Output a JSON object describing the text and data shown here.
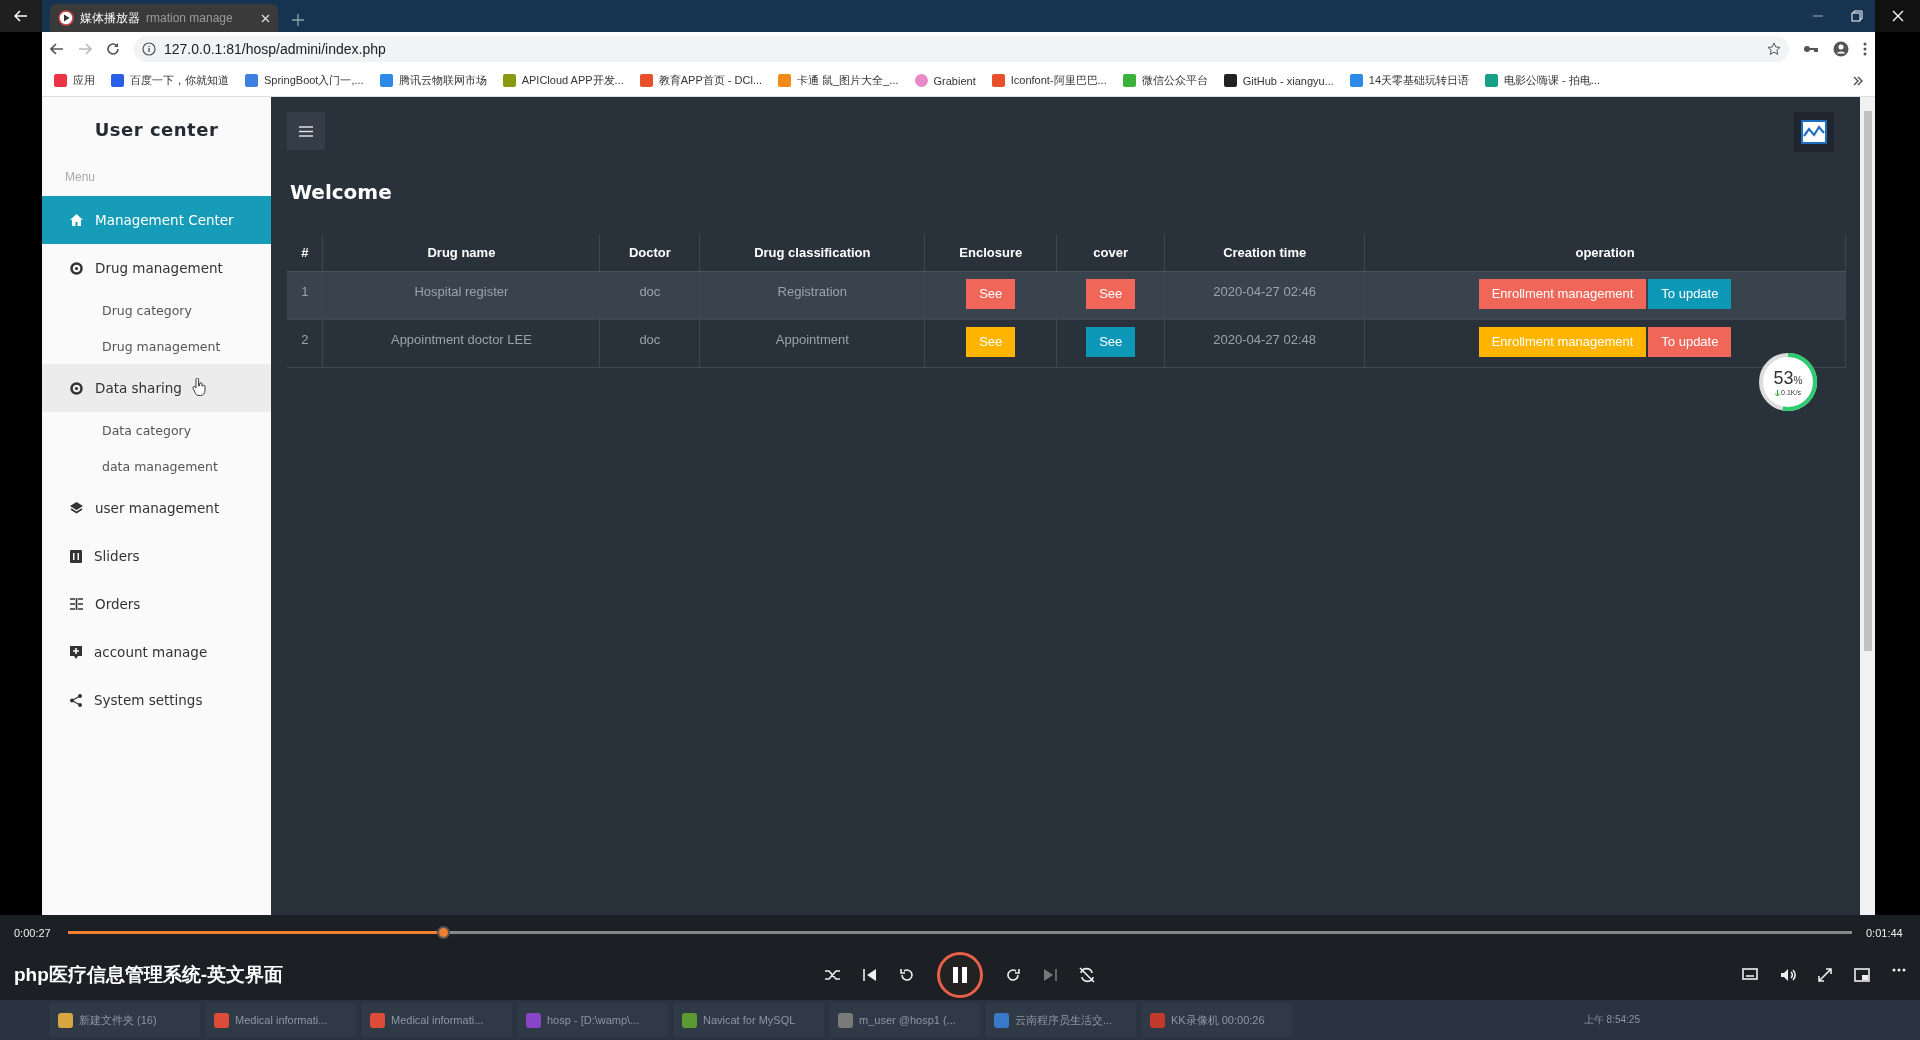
{
  "browser": {
    "tab": {
      "title": "媒体播放器",
      "underlying_title": "rmation manage"
    },
    "address": "127.0.0.1:81/hosp/admini/index.php",
    "bookmarks": [
      {
        "label": "应用"
      },
      {
        "label": "百度一下，你就知道"
      },
      {
        "label": "SpringBoot入门一,..."
      },
      {
        "label": "腾讯云物联网市场"
      },
      {
        "label": "APICloud APP开发..."
      },
      {
        "label": "教育APP首页 - DCl..."
      },
      {
        "label": "卡通 鼠_图片大全_..."
      },
      {
        "label": "Grabient"
      },
      {
        "label": "Iconfont-阿里巴巴..."
      },
      {
        "label": "微信公众平台"
      },
      {
        "label": "GitHub - xiangyu..."
      },
      {
        "label": "14天零基础玩转日语"
      },
      {
        "label": "电影公嗨课 - 拍电..."
      }
    ]
  },
  "sidebar": {
    "title": "User center",
    "menu_label": "Menu",
    "items": [
      {
        "label": "Management Center",
        "selected": true,
        "hovered": false
      },
      {
        "label": "Drug management",
        "selected": false,
        "hovered": false,
        "children": [
          {
            "label": "Drug category"
          },
          {
            "label": "Drug management"
          }
        ]
      },
      {
        "label": "Data sharing",
        "selected": false,
        "hovered": true,
        "children": [
          {
            "label": "Data category"
          },
          {
            "label": "data management"
          }
        ]
      },
      {
        "label": "user management",
        "selected": false,
        "hovered": false
      },
      {
        "label": "Sliders",
        "selected": false,
        "hovered": false
      },
      {
        "label": "Orders",
        "selected": false,
        "hovered": false
      },
      {
        "label": "account manage",
        "selected": false,
        "hovered": false
      },
      {
        "label": "System settings",
        "selected": false,
        "hovered": false
      }
    ]
  },
  "main": {
    "heading": "Welcome",
    "table": {
      "columns": [
        "#",
        "Drug name",
        "Doctor",
        "Drug classification",
        "Enclosure",
        "cover",
        "Creation time",
        "operation"
      ],
      "rows": [
        {
          "id": "1",
          "drug_name": "Hospital register",
          "doctor": "doc",
          "classification": "Registration",
          "enclosure": {
            "label": "See",
            "color": "#f0675a"
          },
          "cover": {
            "label": "See",
            "color": "#f0675a"
          },
          "created": "2020-04-27 02:46",
          "operations": [
            {
              "label": "Enrollment management",
              "color": "#f0675a"
            },
            {
              "label": "To update",
              "color": "#0e98b8"
            }
          ],
          "selected": true
        },
        {
          "id": "2",
          "drug_name": "Appointment doctor LEE",
          "doctor": "doc",
          "classification": "Appointment",
          "enclosure": {
            "label": "See",
            "color": "#ffb400"
          },
          "cover": {
            "label": "See",
            "color": "#0e98b8"
          },
          "created": "2020-04-27 02:48",
          "operations": [
            {
              "label": "Enrollment management",
              "color": "#ffb400"
            },
            {
              "label": "To update",
              "color": "#f0675a"
            }
          ],
          "selected": false
        }
      ]
    }
  },
  "speed_widget": {
    "percent": "53",
    "unit": "%",
    "rate": "0.1K/s",
    "level": 0.53
  },
  "player": {
    "title": "php医疗信息管理系统-英文界面",
    "elapsed": "0:00:27",
    "total": "0:01:44",
    "level": 0.21,
    "playing": true
  },
  "taskbar": {
    "items": [
      {
        "label": "新建文件夹 (16)"
      },
      {
        "label": "Medical informati..."
      },
      {
        "label": "Medical informati..."
      },
      {
        "label": "hosp - [D:\\wamp\\..."
      },
      {
        "label": "Navicat for MySQL"
      },
      {
        "label": "m_user @hosp1 (..."
      },
      {
        "label": "云南程序员生活交..."
      },
      {
        "label": "KK录像机 00:00:26"
      }
    ],
    "clock": "上午 8:54:25"
  }
}
